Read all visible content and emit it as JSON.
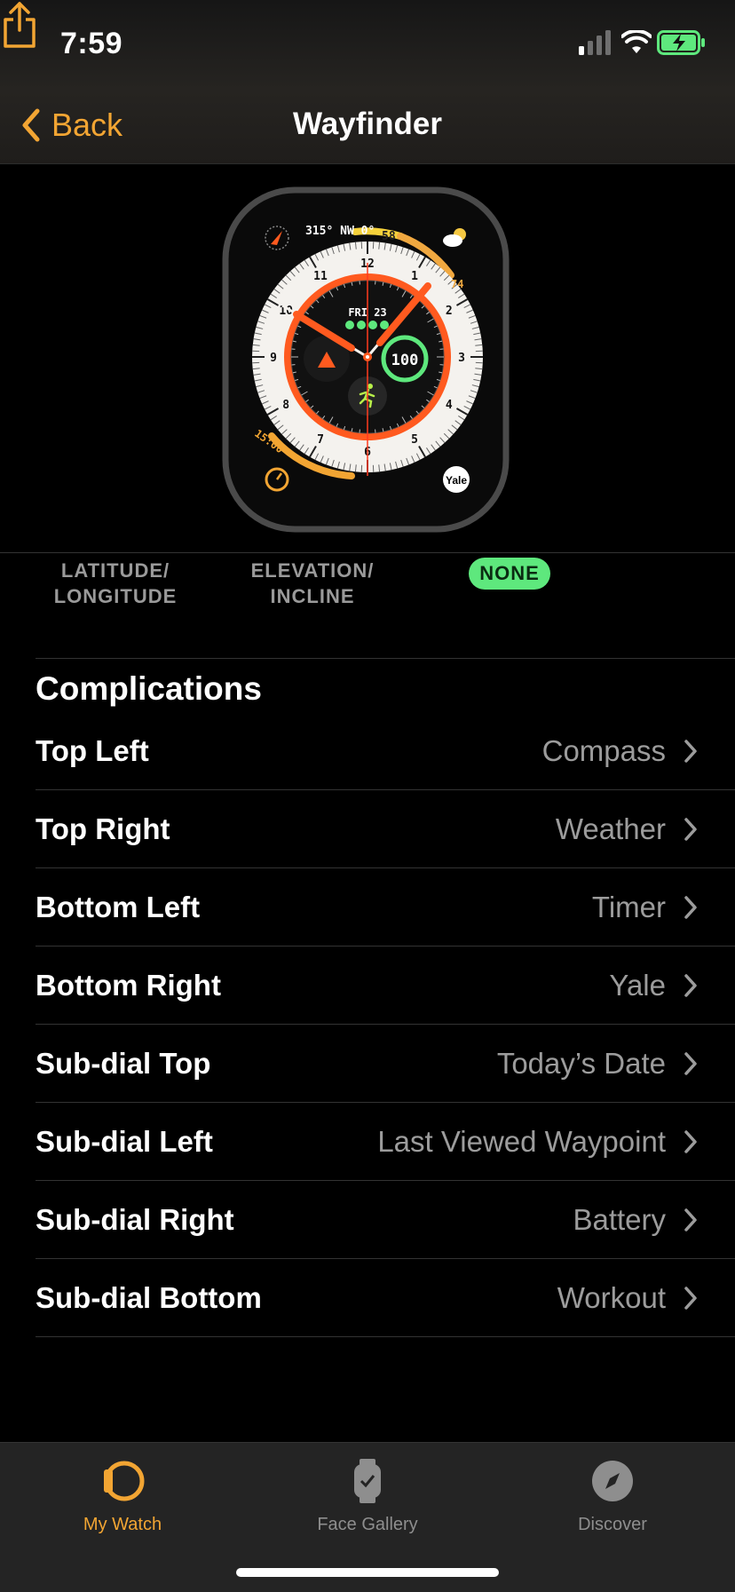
{
  "status_bar": {
    "time": "7:59"
  },
  "nav": {
    "back_label": "Back",
    "title": "Wayfinder"
  },
  "watch_face": {
    "compass_bezel": "315° NW 0°",
    "weather_temp": "58",
    "weather_high": "74",
    "day_date": "FRI 23",
    "battery": "100",
    "timer_value": "15:00",
    "bottom_right_app": "Yale",
    "hour_numbers": [
      "12",
      "1",
      "2",
      "3",
      "4",
      "5",
      "6",
      "7",
      "8",
      "9",
      "10",
      "11"
    ]
  },
  "face_tabs": [
    {
      "label": "LATITUDE/\nLONGITUDE"
    },
    {
      "label": "ELEVATION/\nINCLINE"
    },
    {
      "label": "NONE",
      "selected": true
    }
  ],
  "complications": {
    "title": "Complications",
    "items": [
      {
        "label": "Top Left",
        "value": "Compass"
      },
      {
        "label": "Top Right",
        "value": "Weather"
      },
      {
        "label": "Bottom Left",
        "value": "Timer"
      },
      {
        "label": "Bottom Right",
        "value": "Yale"
      },
      {
        "label": "Sub-dial Top",
        "value": "Today’s Date"
      },
      {
        "label": "Sub-dial Left",
        "value": "Last Viewed Waypoint"
      },
      {
        "label": "Sub-dial Right",
        "value": "Battery"
      },
      {
        "label": "Sub-dial Bottom",
        "value": "Workout"
      }
    ]
  },
  "tab_bar": {
    "items": [
      {
        "label": "My Watch",
        "active": true,
        "icon": "my-watch-icon"
      },
      {
        "label": "Face Gallery",
        "active": false,
        "icon": "face-gallery-icon"
      },
      {
        "label": "Discover",
        "active": false,
        "icon": "discover-icon"
      }
    ]
  },
  "colors": {
    "accent": "#f2a533",
    "selected_tab": "#5ee87d",
    "face_orange": "#ff5a1f"
  }
}
